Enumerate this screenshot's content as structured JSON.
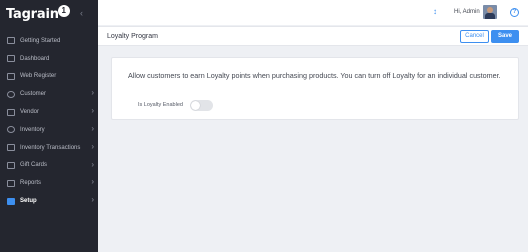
{
  "brand": {
    "name": "Tagrain",
    "mark": "1"
  },
  "sidebar": {
    "collapse_icon": "chevron-left-icon",
    "items": [
      {
        "label": "Getting Started",
        "icon": "rocket-icon",
        "arrow": ""
      },
      {
        "label": "Dashboard",
        "icon": "dashboard-icon",
        "arrow": ""
      },
      {
        "label": "Web Register",
        "icon": "register-icon",
        "arrow": ""
      },
      {
        "label": "Customer",
        "icon": "customer-icon",
        "arrow": "›"
      },
      {
        "label": "Vendor",
        "icon": "vendor-icon",
        "arrow": "›"
      },
      {
        "label": "Inventory",
        "icon": "inventory-icon",
        "arrow": "›"
      },
      {
        "label": "Inventory Transactions",
        "icon": "transactions-icon",
        "arrow": "›"
      },
      {
        "label": "Gift Cards",
        "icon": "gift-card-icon",
        "arrow": "›"
      },
      {
        "label": "Reports",
        "icon": "reports-icon",
        "arrow": "›"
      },
      {
        "label": "Setup",
        "icon": "setup-icon",
        "arrow": "›",
        "active": true
      }
    ]
  },
  "header": {
    "greeting": "Hi, Admin",
    "sync_icon": "↕",
    "help_icon": "?"
  },
  "page": {
    "title": "Loyalty Program",
    "cancel_label": "Cancel",
    "save_label": "Save"
  },
  "loyalty": {
    "description": "Allow customers to earn Loyalty points when purchasing products. You can turn off Loyalty for an individual customer.",
    "toggle_label": "Is Loyalty Enabled",
    "enabled": false
  },
  "colors": {
    "sidebar_bg": "#24262f",
    "accent": "#3d8ff0",
    "page_bg": "#eef0f4"
  }
}
